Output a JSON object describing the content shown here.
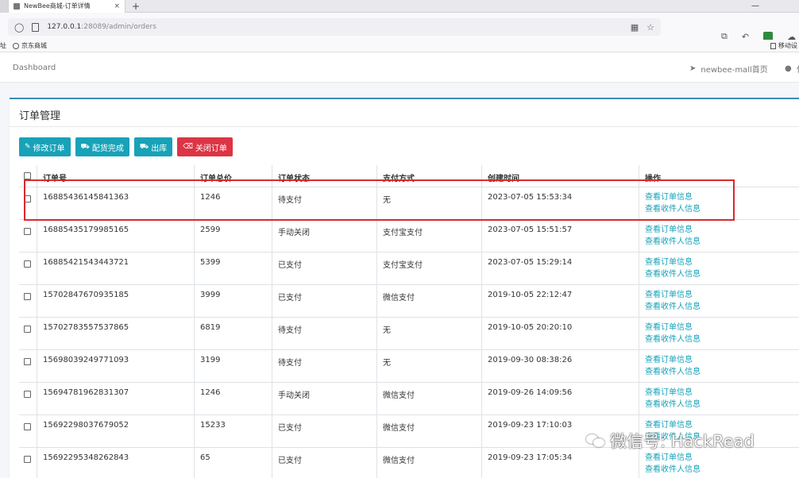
{
  "browser": {
    "tab_title": "NewBee商城-订单详情",
    "tab_close": "×",
    "new_tab": "+",
    "minimize": "—",
    "url_host": "127.0.0.1",
    "url_rest": ":28089/admin/orders",
    "bookmarks": {
      "cut_label": "址",
      "item1": "京东商城",
      "right_item": "移动设"
    }
  },
  "header": {
    "dashboard": "Dashboard",
    "home_link": "newbee-mall首页",
    "user_link": "化"
  },
  "card": {
    "title": "订单管理"
  },
  "buttons": {
    "edit": "修改订单",
    "ship_done": "配货完成",
    "out_stock": "出库",
    "close": "关闭订单"
  },
  "table": {
    "headers": [
      "订单号",
      "订单总价",
      "订单状态",
      "支付方式",
      "创建时间",
      "操作"
    ],
    "action_view_order": "查看订单信息",
    "action_view_receiver": "查看收件人信息",
    "rows": [
      {
        "order_no": "16885436145841363",
        "total": "1246",
        "status": "待支付",
        "pay": "无",
        "created": "2023-07-05 15:53:34"
      },
      {
        "order_no": "16885435179985165",
        "total": "2599",
        "status": "手动关闭",
        "pay": "支付宝支付",
        "created": "2023-07-05 15:51:57"
      },
      {
        "order_no": "16885421543443721",
        "total": "5399",
        "status": "已支付",
        "pay": "支付宝支付",
        "created": "2023-07-05 15:29:14"
      },
      {
        "order_no": "15702847670935185",
        "total": "3999",
        "status": "已支付",
        "pay": "微信支付",
        "created": "2019-10-05 22:12:47"
      },
      {
        "order_no": "15702783557537865",
        "total": "6819",
        "status": "待支付",
        "pay": "无",
        "created": "2019-10-05 20:20:10"
      },
      {
        "order_no": "15698039249771093",
        "total": "3199",
        "status": "待支付",
        "pay": "无",
        "created": "2019-09-30 08:38:26"
      },
      {
        "order_no": "15694781962831307",
        "total": "1246",
        "status": "手动关闭",
        "pay": "微信支付",
        "created": "2019-09-26 14:09:56"
      },
      {
        "order_no": "15692298037679052",
        "total": "15233",
        "status": "已支付",
        "pay": "微信支付",
        "created": "2019-09-23 17:10:03"
      },
      {
        "order_no": "15692295348262843",
        "total": "65",
        "status": "已支付",
        "pay": "微信支付",
        "created": "2019-09-23 17:05:34"
      }
    ]
  },
  "watermark": "微信号: HackRead",
  "colors": {
    "accent": "#17a2b8",
    "danger": "#dc3545",
    "highlight": "#d9292f",
    "card_top": "#3c8dbc"
  }
}
